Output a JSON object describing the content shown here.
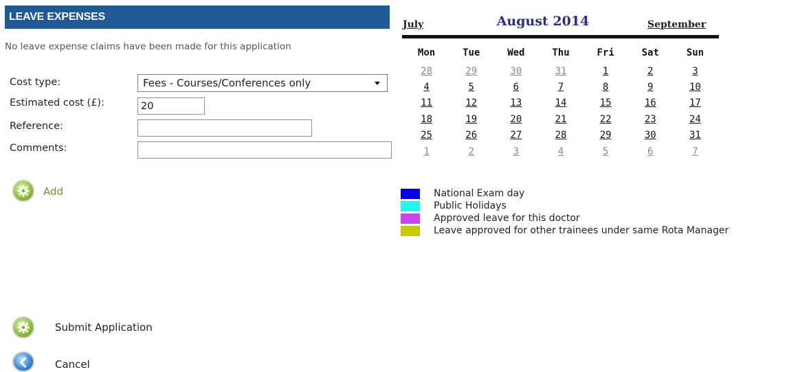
{
  "leave_expenses": {
    "header": "LEAVE EXPENSES",
    "no_claims_text": "No leave expense claims have been made for this application",
    "fields": {
      "cost_type": {
        "label": "Cost type:",
        "value": "Fees - Courses/Conferences only"
      },
      "estimated_cost": {
        "label": "Estimated cost (£):",
        "value": "20"
      },
      "reference": {
        "label": "Reference:",
        "value": ""
      },
      "comments": {
        "label": "Comments:",
        "value": ""
      }
    },
    "add_label": "Add"
  },
  "actions": {
    "submit_label": "Submit Application",
    "cancel_label": "Cancel"
  },
  "calendar": {
    "prev_month": "July",
    "title": "August 2014",
    "next_month": "September",
    "weekdays": [
      "Mon",
      "Tue",
      "Wed",
      "Thu",
      "Fri",
      "Sat",
      "Sun"
    ],
    "weeks": [
      [
        {
          "d": "28",
          "other": true
        },
        {
          "d": "29",
          "other": true
        },
        {
          "d": "30",
          "other": true
        },
        {
          "d": "31",
          "other": true
        },
        {
          "d": "1",
          "other": false
        },
        {
          "d": "2",
          "other": false
        },
        {
          "d": "3",
          "other": false
        }
      ],
      [
        {
          "d": "4",
          "other": false
        },
        {
          "d": "5",
          "other": false
        },
        {
          "d": "6",
          "other": false
        },
        {
          "d": "7",
          "other": false
        },
        {
          "d": "8",
          "other": false
        },
        {
          "d": "9",
          "other": false
        },
        {
          "d": "10",
          "other": false
        }
      ],
      [
        {
          "d": "11",
          "other": false
        },
        {
          "d": "12",
          "other": false
        },
        {
          "d": "13",
          "other": false
        },
        {
          "d": "14",
          "other": false
        },
        {
          "d": "15",
          "other": false
        },
        {
          "d": "16",
          "other": false
        },
        {
          "d": "17",
          "other": false
        }
      ],
      [
        {
          "d": "18",
          "other": false
        },
        {
          "d": "19",
          "other": false
        },
        {
          "d": "20",
          "other": false
        },
        {
          "d": "21",
          "other": false
        },
        {
          "d": "22",
          "other": false
        },
        {
          "d": "23",
          "other": false
        },
        {
          "d": "24",
          "other": false
        }
      ],
      [
        {
          "d": "25",
          "other": false
        },
        {
          "d": "26",
          "other": false
        },
        {
          "d": "27",
          "other": false
        },
        {
          "d": "28",
          "other": false
        },
        {
          "d": "29",
          "other": false
        },
        {
          "d": "30",
          "other": false
        },
        {
          "d": "31",
          "other": false
        }
      ],
      [
        {
          "d": "1",
          "other": true
        },
        {
          "d": "2",
          "other": true
        },
        {
          "d": "3",
          "other": true
        },
        {
          "d": "4",
          "other": true
        },
        {
          "d": "5",
          "other": true
        },
        {
          "d": "6",
          "other": true
        },
        {
          "d": "7",
          "other": true
        }
      ]
    ]
  },
  "legend": [
    {
      "label": "National Exam day",
      "color": "#0000ee"
    },
    {
      "label": "Public Holidays",
      "color": "#22f5f5"
    },
    {
      "label": "Approved leave for this doctor",
      "color": "#cc44f0"
    },
    {
      "label": "Leave approved for other trainees under same Rota Manager",
      "color": "#c8c800"
    }
  ],
  "colors": {
    "header_bg": "#1f5a96",
    "calendar_title": "#2b2b8a",
    "add_text": "#6a9a27"
  }
}
